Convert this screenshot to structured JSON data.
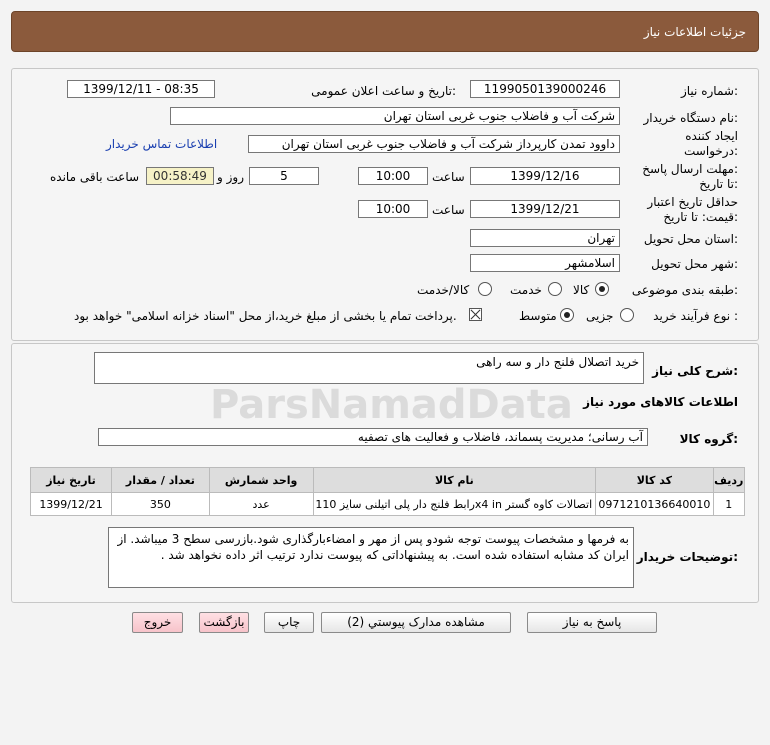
{
  "header": {
    "title": "جزئیات اطلاعات نیاز"
  },
  "form": {
    "need_number_label": "شماره نیاز:",
    "need_number": "1199050139000246",
    "announce_label": "تاریخ و ساعت اعلان عمومی:",
    "announce_value": "1399/12/11 - 08:35",
    "buyer_org_label": "نام دستگاه خریدار:",
    "buyer_org": "شرکت آب و فاضلاب جنوب غربی استان تهران",
    "creator_label_1": "ایجاد کننده",
    "creator_label_2": "درخواست:",
    "creator": "داوود  تمدن  کارپرداز شرکت آب و فاضلاب جنوب غربی استان تهران",
    "contact_link": "اطلاعات تماس خریدار",
    "deadline_label_1": "مهلت ارسال پاسخ:",
    "deadline_label_2": "تا تاریخ:",
    "deadline_date": "1399/12/16",
    "time_label": "ساعت",
    "deadline_time": "10:00",
    "days_value": "5",
    "days_label": "روز و",
    "remaining_time": "00:58:49",
    "remaining_label": "ساعت باقی مانده",
    "validity_label_1": "حداقل تاریخ اعتبار",
    "validity_label_2": "قیمت: تا تاریخ:",
    "validity_date": "1399/12/21",
    "validity_time": "10:00",
    "province_label": "استان محل تحویل:",
    "province": "تهران",
    "city_label": "شهر محل تحویل:",
    "city": "اسلامشهر",
    "category_label": "طبقه بندی موضوعی:",
    "category_options": [
      "کالا",
      "خدمت",
      "کالا/خدمت"
    ],
    "purchase_type_label": "نوع فرآیند خرید :",
    "purchase_options": [
      "جزیی",
      "متوسط"
    ],
    "payment_note": "پرداخت تمام یا بخشی از مبلغ خرید،از محل \"اسناد خزانه اسلامی\" خواهد بود."
  },
  "summary": {
    "label": "شرح کلی نیاز:",
    "value": "خرید اتصلال فلنج دار و سه راهی"
  },
  "goods_info": {
    "title": "اطلاعات کالاهای مورد نیاز",
    "group_label": "گروه کالا:",
    "group_value": "آب رسانی؛ مدیریت پسماند، فاضلاب و فعالیت های تصفیه"
  },
  "table": {
    "headers": [
      "ردیف",
      "کد کالا",
      "نام کالا",
      "واحد شمارش",
      "تعداد / مقدار",
      "تاریخ نیاز"
    ],
    "rows": [
      [
        "1",
        "0971210136640010",
        "رابط فلنج دار پلی اتیلنی سایز 110x4 in اتصالات کاوه گستر",
        "عدد",
        "350",
        "1399/12/21"
      ]
    ]
  },
  "buyer_notes": {
    "label": "توضیحات خریدار:",
    "text": "به فرمها و مشخصات پیوست توجه شودو پس از مهر و امضاءبارگذاری شود.بازرسی سطح 3 میباشد. از ایران کد مشابه استفاده شده است. به پیشنهاداتی که پیوست ندارد ترتیب اثر داده نخواهد شد ."
  },
  "buttons": {
    "reply": "پاسخ به نیاز",
    "attachments": "مشاهده مدارک پیوستي (2)",
    "print": "چاپ",
    "back": "بازگشت",
    "exit": "خروج"
  },
  "watermark": {
    "brand": "ParsNamadData"
  },
  "colors": {
    "header": "#8b5a3c",
    "link": "#1a3fb0",
    "timer_bg": "#f6f2c7",
    "pink_button": "#f7c3ca"
  }
}
